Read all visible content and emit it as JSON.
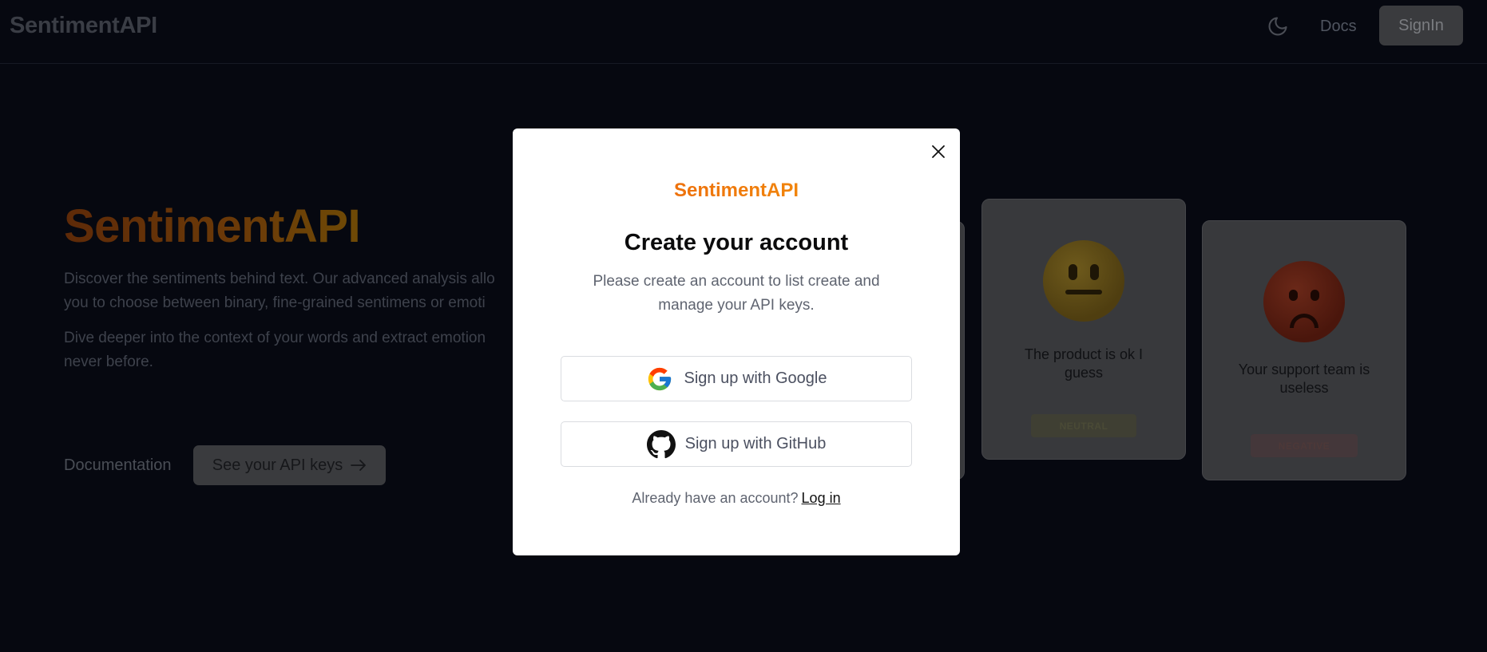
{
  "navbar": {
    "brand": "SentimentAPI",
    "docs_label": "Docs",
    "signin_label": "SignIn",
    "theme_icon": "moon-icon"
  },
  "hero": {
    "title": "SentimentAPI",
    "paragraph1_line1": "Discover the sentiments behind text. Our advanced analysis allo",
    "paragraph1_line2": "you to choose between binary, fine-grained sentimens or emoti",
    "paragraph2_line1": "Dive deeper into the context of your words and extract emotion",
    "paragraph2_line2": "never before.",
    "documentation_link": "Documentation",
    "api_keys_button": "See your API keys",
    "api_keys_icon": "arrow-right-icon"
  },
  "cards": [
    {
      "emoji": "neutral-face",
      "text": "The product is ok I guess",
      "badge": "NEUTRAL",
      "badge_color": "#eab308"
    },
    {
      "emoji": "angry-face",
      "text": "Your support team is useless",
      "badge": "NEGATIVE",
      "badge_color": "#ef4444"
    }
  ],
  "modal": {
    "brand": "SentimentAPI",
    "title": "Create your account",
    "subtitle": "Please create an account to list create and manage your API keys.",
    "google_button": "Sign up with Google",
    "github_button": "Sign up with GitHub",
    "footer_text": "Already have an account?",
    "login_link": "Log in",
    "close_icon": "close-icon",
    "brand_gradient": [
      "#ea580c",
      "#f59e0b"
    ]
  },
  "colors": {
    "background": "#060810",
    "modal_background": "#ffffff",
    "accent_orange": "#ea580c"
  }
}
